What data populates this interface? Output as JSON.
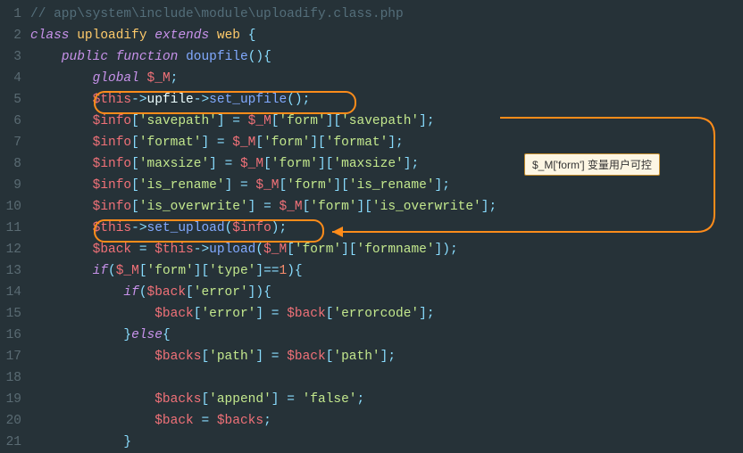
{
  "annotation": {
    "label": "$_M['form'] 变量用户可控"
  },
  "lines": [
    {
      "n": 1,
      "tokens": [
        [
          "cmt",
          "// app\\system\\include\\module\\uploadify.class.php"
        ]
      ]
    },
    {
      "n": 2,
      "tokens": [
        [
          "kw",
          "class"
        ],
        [
          "plain",
          " "
        ],
        [
          "cls",
          "uploadify"
        ],
        [
          "plain",
          " "
        ],
        [
          "kw",
          "extends"
        ],
        [
          "plain",
          " "
        ],
        [
          "cls",
          "web"
        ],
        [
          "plain",
          " "
        ],
        [
          "pun",
          "{"
        ]
      ]
    },
    {
      "n": 3,
      "tokens": [
        [
          "plain",
          "    "
        ],
        [
          "kw",
          "public"
        ],
        [
          "plain",
          " "
        ],
        [
          "kw",
          "function"
        ],
        [
          "plain",
          " "
        ],
        [
          "fn",
          "doupfile"
        ],
        [
          "pun",
          "()"
        ],
        [
          "pun",
          "{"
        ]
      ]
    },
    {
      "n": 4,
      "tokens": [
        [
          "plain",
          "        "
        ],
        [
          "kw",
          "global"
        ],
        [
          "plain",
          " "
        ],
        [
          "var",
          "$_M"
        ],
        [
          "pun",
          ";"
        ]
      ]
    },
    {
      "n": 5,
      "tokens": [
        [
          "plain",
          "        "
        ],
        [
          "var",
          "$this"
        ],
        [
          "op",
          "->"
        ],
        [
          "plain",
          "upfile"
        ],
        [
          "op",
          "->"
        ],
        [
          "fn",
          "set_upfile"
        ],
        [
          "pun",
          "();"
        ]
      ]
    },
    {
      "n": 6,
      "tokens": [
        [
          "plain",
          "        "
        ],
        [
          "var",
          "$info"
        ],
        [
          "pun",
          "["
        ],
        [
          "str",
          "'savepath'"
        ],
        [
          "pun",
          "]"
        ],
        [
          "plain",
          " "
        ],
        [
          "op",
          "="
        ],
        [
          "plain",
          " "
        ],
        [
          "var",
          "$_M"
        ],
        [
          "pun",
          "["
        ],
        [
          "str",
          "'form'"
        ],
        [
          "pun",
          "]"
        ],
        [
          "pun",
          "["
        ],
        [
          "str",
          "'savepath'"
        ],
        [
          "pun",
          "]"
        ],
        [
          "pun",
          ";"
        ]
      ]
    },
    {
      "n": 7,
      "tokens": [
        [
          "plain",
          "        "
        ],
        [
          "var",
          "$info"
        ],
        [
          "pun",
          "["
        ],
        [
          "str",
          "'format'"
        ],
        [
          "pun",
          "]"
        ],
        [
          "plain",
          " "
        ],
        [
          "op",
          "="
        ],
        [
          "plain",
          " "
        ],
        [
          "var",
          "$_M"
        ],
        [
          "pun",
          "["
        ],
        [
          "str",
          "'form'"
        ],
        [
          "pun",
          "]"
        ],
        [
          "pun",
          "["
        ],
        [
          "str",
          "'format'"
        ],
        [
          "pun",
          "]"
        ],
        [
          "pun",
          ";"
        ]
      ]
    },
    {
      "n": 8,
      "tokens": [
        [
          "plain",
          "        "
        ],
        [
          "var",
          "$info"
        ],
        [
          "pun",
          "["
        ],
        [
          "str",
          "'maxsize'"
        ],
        [
          "pun",
          "]"
        ],
        [
          "plain",
          " "
        ],
        [
          "op",
          "="
        ],
        [
          "plain",
          " "
        ],
        [
          "var",
          "$_M"
        ],
        [
          "pun",
          "["
        ],
        [
          "str",
          "'form'"
        ],
        [
          "pun",
          "]"
        ],
        [
          "pun",
          "["
        ],
        [
          "str",
          "'maxsize'"
        ],
        [
          "pun",
          "]"
        ],
        [
          "pun",
          ";"
        ]
      ]
    },
    {
      "n": 9,
      "tokens": [
        [
          "plain",
          "        "
        ],
        [
          "var",
          "$info"
        ],
        [
          "pun",
          "["
        ],
        [
          "str",
          "'is_rename'"
        ],
        [
          "pun",
          "]"
        ],
        [
          "plain",
          " "
        ],
        [
          "op",
          "="
        ],
        [
          "plain",
          " "
        ],
        [
          "var",
          "$_M"
        ],
        [
          "pun",
          "["
        ],
        [
          "str",
          "'form'"
        ],
        [
          "pun",
          "]"
        ],
        [
          "pun",
          "["
        ],
        [
          "str",
          "'is_rename'"
        ],
        [
          "pun",
          "]"
        ],
        [
          "pun",
          ";"
        ]
      ]
    },
    {
      "n": 10,
      "tokens": [
        [
          "plain",
          "        "
        ],
        [
          "var",
          "$info"
        ],
        [
          "pun",
          "["
        ],
        [
          "str",
          "'is_overwrite'"
        ],
        [
          "pun",
          "]"
        ],
        [
          "plain",
          " "
        ],
        [
          "op",
          "="
        ],
        [
          "plain",
          " "
        ],
        [
          "var",
          "$_M"
        ],
        [
          "pun",
          "["
        ],
        [
          "str",
          "'form'"
        ],
        [
          "pun",
          "]"
        ],
        [
          "pun",
          "["
        ],
        [
          "str",
          "'is_overwrite'"
        ],
        [
          "pun",
          "]"
        ],
        [
          "pun",
          ";"
        ]
      ]
    },
    {
      "n": 11,
      "tokens": [
        [
          "plain",
          "        "
        ],
        [
          "var",
          "$this"
        ],
        [
          "op",
          "->"
        ],
        [
          "fn",
          "set_upload"
        ],
        [
          "pun",
          "("
        ],
        [
          "var",
          "$info"
        ],
        [
          "pun",
          ");"
        ]
      ]
    },
    {
      "n": 12,
      "tokens": [
        [
          "plain",
          "        "
        ],
        [
          "var",
          "$back"
        ],
        [
          "plain",
          " "
        ],
        [
          "op",
          "="
        ],
        [
          "plain",
          " "
        ],
        [
          "var",
          "$this"
        ],
        [
          "op",
          "->"
        ],
        [
          "fn",
          "upload"
        ],
        [
          "pun",
          "("
        ],
        [
          "var",
          "$_M"
        ],
        [
          "pun",
          "["
        ],
        [
          "str",
          "'form'"
        ],
        [
          "pun",
          "]"
        ],
        [
          "pun",
          "["
        ],
        [
          "str",
          "'formname'"
        ],
        [
          "pun",
          "]"
        ],
        [
          "pun",
          ");"
        ]
      ]
    },
    {
      "n": 13,
      "tokens": [
        [
          "plain",
          "        "
        ],
        [
          "kw",
          "if"
        ],
        [
          "pun",
          "("
        ],
        [
          "var",
          "$_M"
        ],
        [
          "pun",
          "["
        ],
        [
          "str",
          "'form'"
        ],
        [
          "pun",
          "]"
        ],
        [
          "pun",
          "["
        ],
        [
          "str",
          "'type'"
        ],
        [
          "pun",
          "]"
        ],
        [
          "op",
          "=="
        ],
        [
          "num",
          "1"
        ],
        [
          "pun",
          ")"
        ],
        [
          "pun",
          "{"
        ]
      ]
    },
    {
      "n": 14,
      "tokens": [
        [
          "plain",
          "            "
        ],
        [
          "kw",
          "if"
        ],
        [
          "pun",
          "("
        ],
        [
          "var",
          "$back"
        ],
        [
          "pun",
          "["
        ],
        [
          "str",
          "'error'"
        ],
        [
          "pun",
          "]"
        ],
        [
          "pun",
          ")"
        ],
        [
          "pun",
          "{"
        ]
      ]
    },
    {
      "n": 15,
      "tokens": [
        [
          "plain",
          "                "
        ],
        [
          "var",
          "$back"
        ],
        [
          "pun",
          "["
        ],
        [
          "str",
          "'error'"
        ],
        [
          "pun",
          "]"
        ],
        [
          "plain",
          " "
        ],
        [
          "op",
          "="
        ],
        [
          "plain",
          " "
        ],
        [
          "var",
          "$back"
        ],
        [
          "pun",
          "["
        ],
        [
          "str",
          "'errorcode'"
        ],
        [
          "pun",
          "]"
        ],
        [
          "pun",
          ";"
        ]
      ]
    },
    {
      "n": 16,
      "tokens": [
        [
          "plain",
          "            "
        ],
        [
          "pun",
          "}"
        ],
        [
          "kw",
          "else"
        ],
        [
          "pun",
          "{"
        ]
      ]
    },
    {
      "n": 17,
      "tokens": [
        [
          "plain",
          "                "
        ],
        [
          "var",
          "$backs"
        ],
        [
          "pun",
          "["
        ],
        [
          "str",
          "'path'"
        ],
        [
          "pun",
          "]"
        ],
        [
          "plain",
          " "
        ],
        [
          "op",
          "="
        ],
        [
          "plain",
          " "
        ],
        [
          "var",
          "$back"
        ],
        [
          "pun",
          "["
        ],
        [
          "str",
          "'path'"
        ],
        [
          "pun",
          "]"
        ],
        [
          "pun",
          ";"
        ]
      ]
    },
    {
      "n": 18,
      "tokens": []
    },
    {
      "n": 19,
      "tokens": [
        [
          "plain",
          "                "
        ],
        [
          "var",
          "$backs"
        ],
        [
          "pun",
          "["
        ],
        [
          "str",
          "'append'"
        ],
        [
          "pun",
          "]"
        ],
        [
          "plain",
          " "
        ],
        [
          "op",
          "="
        ],
        [
          "plain",
          " "
        ],
        [
          "str",
          "'false'"
        ],
        [
          "pun",
          ";"
        ]
      ]
    },
    {
      "n": 20,
      "tokens": [
        [
          "plain",
          "                "
        ],
        [
          "var",
          "$back"
        ],
        [
          "plain",
          " "
        ],
        [
          "op",
          "="
        ],
        [
          "plain",
          " "
        ],
        [
          "var",
          "$backs"
        ],
        [
          "pun",
          ";"
        ]
      ]
    },
    {
      "n": 21,
      "tokens": [
        [
          "plain",
          "            "
        ],
        [
          "pun",
          "}"
        ]
      ]
    }
  ]
}
